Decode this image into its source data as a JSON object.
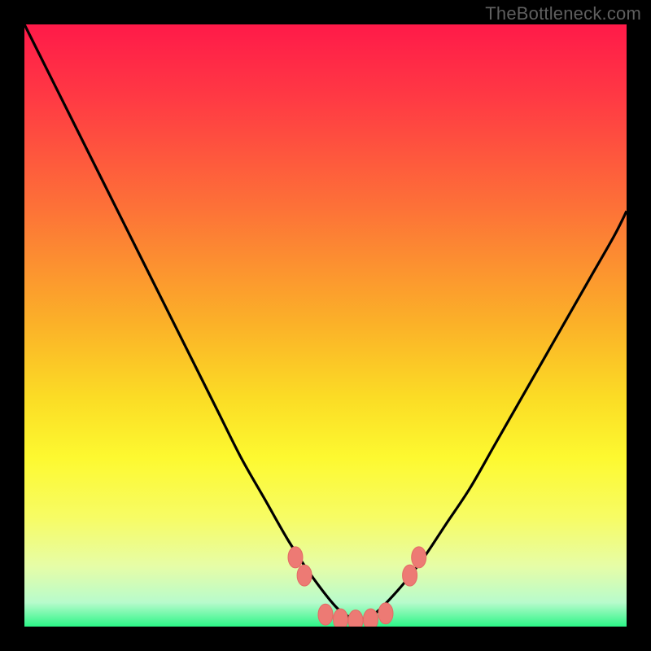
{
  "watermark": "TheBottleneck.com",
  "colors": {
    "frame": "#000000",
    "curve": "#000000",
    "marker_fill": "#ED7A74",
    "marker_stroke": "#E36A65",
    "gradient_stops": [
      {
        "offset": 0.0,
        "color": "#FF1A49"
      },
      {
        "offset": 0.12,
        "color": "#FF3944"
      },
      {
        "offset": 0.3,
        "color": "#FD7038"
      },
      {
        "offset": 0.5,
        "color": "#FBB228"
      },
      {
        "offset": 0.62,
        "color": "#FBDC25"
      },
      {
        "offset": 0.72,
        "color": "#FDF930"
      },
      {
        "offset": 0.82,
        "color": "#F7FC65"
      },
      {
        "offset": 0.9,
        "color": "#E6FDA7"
      },
      {
        "offset": 0.96,
        "color": "#B8FBCC"
      },
      {
        "offset": 1.0,
        "color": "#2CF587"
      }
    ]
  },
  "chart_data": {
    "type": "line",
    "title": "",
    "xlabel": "",
    "ylabel": "",
    "xlim": [
      0,
      100
    ],
    "ylim": [
      0,
      100
    ],
    "series": [
      {
        "name": "bottleneck-curve-left",
        "x": [
          0,
          4,
          8,
          12,
          16,
          20,
          24,
          28,
          32,
          36,
          40,
          44,
          48,
          52,
          55
        ],
        "y": [
          100,
          92,
          84,
          76,
          68,
          60,
          52,
          44,
          36,
          28,
          21,
          14,
          8,
          3,
          1
        ]
      },
      {
        "name": "bottleneck-curve-right",
        "x": [
          55,
          58,
          62,
          66,
          70,
          74,
          78,
          82,
          86,
          90,
          94,
          98,
          100
        ],
        "y": [
          1,
          2,
          6,
          11,
          17,
          23,
          30,
          37,
          44,
          51,
          58,
          65,
          69
        ]
      }
    ],
    "markers": {
      "name": "highlight-dots",
      "points": [
        {
          "x": 45.0,
          "y": 11.5
        },
        {
          "x": 46.5,
          "y": 8.5
        },
        {
          "x": 50.0,
          "y": 2.0
        },
        {
          "x": 52.5,
          "y": 1.2
        },
        {
          "x": 55.0,
          "y": 1.0
        },
        {
          "x": 57.5,
          "y": 1.2
        },
        {
          "x": 60.0,
          "y": 2.2
        },
        {
          "x": 64.0,
          "y": 8.5
        },
        {
          "x": 65.5,
          "y": 11.5
        }
      ]
    }
  }
}
